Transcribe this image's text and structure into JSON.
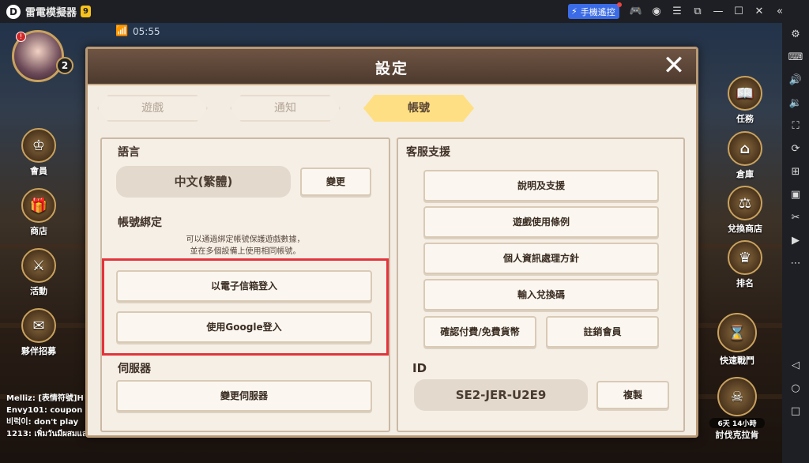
{
  "emulator": {
    "title": "雷電模擬器",
    "badge": "9",
    "remote_label": "手機遙控",
    "top_icons": [
      "gamepad-icon",
      "user-icon",
      "menu-icon",
      "restore-icon",
      "minimize-icon",
      "maximize-icon",
      "close-icon",
      "collapse-icon"
    ],
    "side_icons": [
      "settings-icon",
      "keyboard-icon",
      "volume-up-icon",
      "volume-down-icon",
      "screenshot-icon",
      "rotate-icon",
      "add-window-icon",
      "apk-icon",
      "scissors-icon",
      "record-icon",
      "more-icon",
      "back-icon",
      "home-icon",
      "recent-icon"
    ]
  },
  "game": {
    "clock": "05:55",
    "level": "2",
    "left_hud": [
      {
        "label": "會員"
      },
      {
        "label": "商店"
      },
      {
        "label": "活動"
      },
      {
        "label": "夥伴招募"
      }
    ],
    "right_hud": [
      {
        "label": "任務"
      },
      {
        "label": "倉庫"
      },
      {
        "label": "兌換商店"
      },
      {
        "label": "排名"
      },
      {
        "label": "快速戰鬥"
      },
      {
        "label": "討伐克拉肯"
      }
    ],
    "timer_label": "6天 14小時",
    "chat": [
      "Melliz: [表情符號]H",
      "Envy101: coupon",
      "비럭이: don't play",
      "1213: เพิ่มวันมีผสมแล"
    ]
  },
  "modal": {
    "title": "設定",
    "close_glyph": "✕",
    "tabs": [
      {
        "label": "遊戲",
        "active": false
      },
      {
        "label": "通知",
        "active": false
      },
      {
        "label": "帳號",
        "active": true
      }
    ],
    "left": {
      "language_label": "語言",
      "language_value": "中文(繁體)",
      "change_label": "變更",
      "binding_label": "帳號綁定",
      "binding_hint_1": "可以通過綁定帳號保護遊戲數據，",
      "binding_hint_2": "並在多個設備上使用相同帳號。",
      "email_login": "以電子信箱登入",
      "google_login": "使用Google登入",
      "server_label": "伺服器",
      "change_server": "變更伺服器"
    },
    "right": {
      "support_label": "客服支援",
      "help": "說明及支援",
      "terms": "遊戲使用條例",
      "privacy": "個人資訊處理方針",
      "coupon": "輸入兌換碼",
      "payment": "確認付費/免費貨幣",
      "delete": "註銷會員",
      "id_label": "ID",
      "id_value": "SE2-JER-U2E9",
      "copy": "複製"
    }
  },
  "colors": {
    "highlight": "#e4333a",
    "active_tab": "#ffdf83",
    "header": "#5c4638"
  }
}
